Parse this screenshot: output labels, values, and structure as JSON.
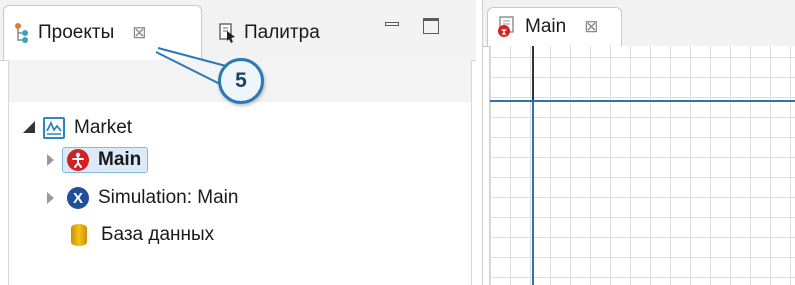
{
  "left": {
    "tabs": [
      {
        "label": "Проекты",
        "icon": "projects-icon",
        "close": "⊠"
      },
      {
        "label": "Палитра",
        "icon": "palette-icon"
      }
    ],
    "tree": [
      {
        "label": "Market",
        "icon": "model-icon",
        "expanded": true
      },
      {
        "label": "Main",
        "icon": "agent-type-icon",
        "selected": true
      },
      {
        "label": "Simulation: Main",
        "icon": "experiment-icon",
        "badge": "X"
      },
      {
        "label": "База данных",
        "icon": "database-icon"
      }
    ],
    "callout": "5"
  },
  "right": {
    "tab": {
      "label": "Main",
      "icon": "agent-diagram-icon",
      "close": "⊠"
    }
  },
  "colors": {
    "accent": "#2f6fb3",
    "agent": "#d42020",
    "experiment": "#1f4f9a",
    "database": "#f4c21c",
    "selection": "#dceaf7"
  }
}
